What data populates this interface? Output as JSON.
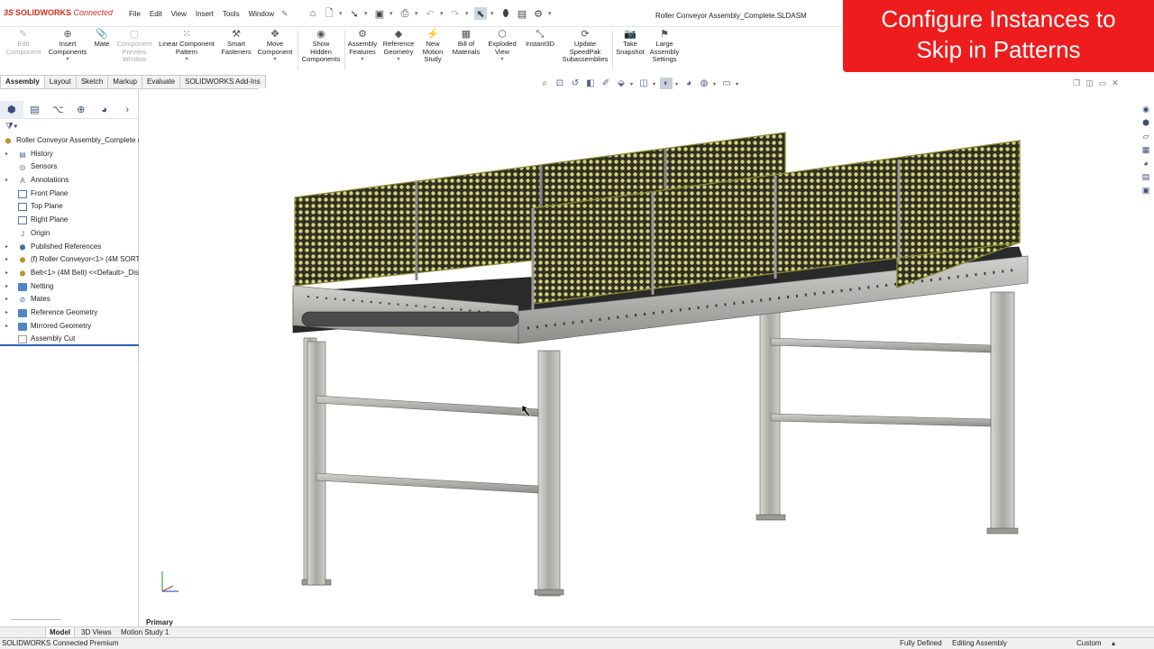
{
  "app": {
    "logo_prefix": "3S",
    "logo_brand": "SOLIDWORKS",
    "logo_suffix": "Connected",
    "menu": [
      "File",
      "Edit",
      "View",
      "Insert",
      "Tools",
      "Window"
    ],
    "document_title": "Roller Conveyor Assembly_Complete.SLDASM"
  },
  "banner": {
    "line1": "Configure Instances to",
    "line2": "Skip in Patterns",
    "color": "#ee1c1c"
  },
  "ribbon": {
    "edit_component": [
      "Edit",
      "Component"
    ],
    "insert_components": [
      "Insert",
      "Components"
    ],
    "mate": [
      "Mate"
    ],
    "component_preview": [
      "Component",
      "Preview",
      "Window"
    ],
    "linear_pattern": [
      "Linear Component",
      "Pattern"
    ],
    "smart_fasteners": [
      "Smart",
      "Fasteners"
    ],
    "move_component": [
      "Move",
      "Component"
    ],
    "show_hidden": [
      "Show",
      "Hidden",
      "Components"
    ],
    "assembly_features": [
      "Assembly",
      "Features"
    ],
    "reference_geometry": [
      "Reference",
      "Geometry"
    ],
    "new_motion_study": [
      "New",
      "Motion",
      "Study"
    ],
    "bill_of_materials": [
      "Bill of",
      "Materials"
    ],
    "exploded_view": [
      "Exploded",
      "View"
    ],
    "instant3d": [
      "Instant3D"
    ],
    "update_speedpak": [
      "Update",
      "SpeedPak",
      "Subassemblies"
    ],
    "take_snapshot": [
      "Take",
      "Snapshot"
    ],
    "large_assembly": [
      "Large",
      "Assembly",
      "Settings"
    ]
  },
  "command_tabs": [
    "Assembly",
    "Layout",
    "Sketch",
    "Markup",
    "Evaluate",
    "SOLIDWORKS Add-Ins"
  ],
  "tree": {
    "root": "Roller Conveyor Assembly_Complete (",
    "items": [
      {
        "label": "History",
        "icon": "history-icon",
        "expandable": true
      },
      {
        "label": "Sensors",
        "icon": "sensor-icon",
        "expandable": false
      },
      {
        "label": "Annotations",
        "icon": "annotation-icon",
        "expandable": true
      },
      {
        "label": "Front Plane",
        "icon": "plane-icon",
        "expandable": false
      },
      {
        "label": "Top Plane",
        "icon": "plane-icon",
        "expandable": false
      },
      {
        "label": "Right Plane",
        "icon": "plane-icon",
        "expandable": false
      },
      {
        "label": "Origin",
        "icon": "origin-icon",
        "expandable": false
      },
      {
        "label": "Published References",
        "icon": "published-refs-icon",
        "expandable": true
      },
      {
        "label": "(f) Roller Conveyor<1> (4M SORT",
        "icon": "subassembly-icon",
        "expandable": true
      },
      {
        "label": "Belt<1> (4M Belt) <<Default>_Dis",
        "icon": "subassembly-icon",
        "expandable": true
      },
      {
        "label": "Netting",
        "icon": "folder-icon",
        "expandable": true
      },
      {
        "label": "Mates",
        "icon": "mates-icon",
        "expandable": true
      },
      {
        "label": "Reference Geometry",
        "icon": "folder-icon",
        "expandable": true
      },
      {
        "label": "Mirrored Geometry",
        "icon": "folder-icon",
        "expandable": true
      },
      {
        "label": "Assembly Cut",
        "icon": "cut-folder-icon",
        "expandable": false
      }
    ]
  },
  "viewport": {
    "view_orientation": "Primary"
  },
  "bottom_tabs": [
    "Model",
    "3D Views",
    "Motion Study 1"
  ],
  "status": {
    "product": "SOLIDWORKS Connected Premium",
    "state": "Fully Defined",
    "mode": "Editing Assembly",
    "units": "Custom"
  }
}
